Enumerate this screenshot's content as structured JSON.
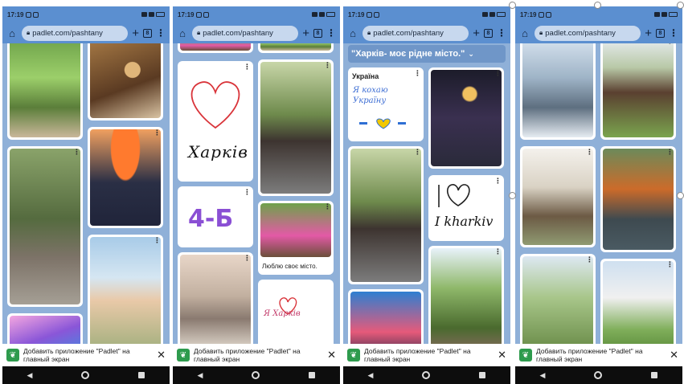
{
  "status": {
    "time": "17:19"
  },
  "browser": {
    "url": "padlet.com/pashtany",
    "tab_count": "8"
  },
  "banner": {
    "text": "Добавить приложение \"Padlet\" на главный экран"
  },
  "phone2": {
    "kids_caption": "Люблю своє місто.",
    "heart_card_text": "Харків",
    "class_card_text": "4-Б",
    "small_heart_text": "Я Харків"
  },
  "phone3": {
    "section_title": "\"Харків- моє рідне місто.\"",
    "ukraine_card_title": "Україна",
    "ukraine_card_text": "Я кохаю Україну",
    "kharkiv_card_text": "I kharkiv"
  },
  "colors": {
    "board_bg": "#8fb0d8",
    "browser_bar": "#5b8fd0",
    "padlet_green": "#2e9b4d"
  }
}
